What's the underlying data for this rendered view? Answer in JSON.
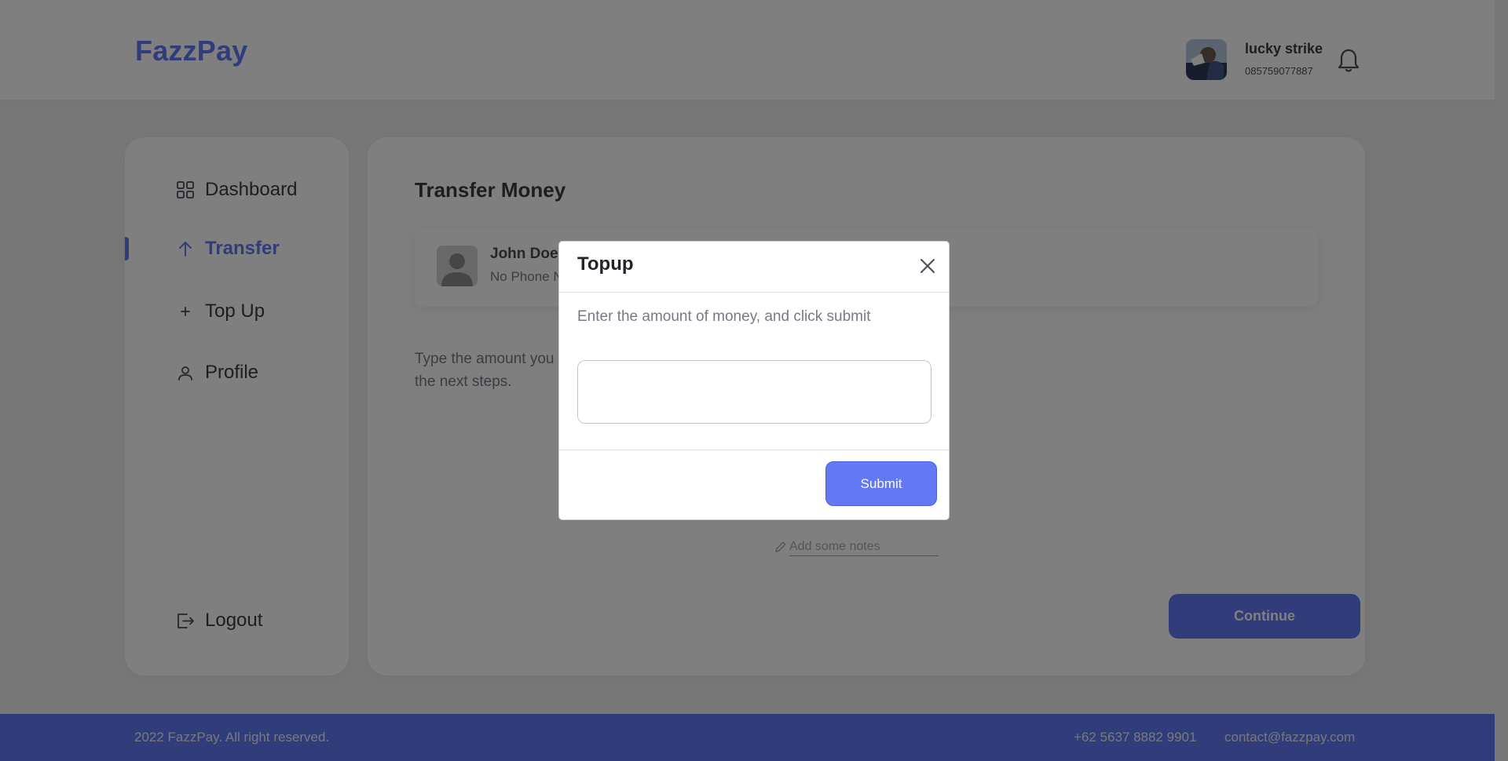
{
  "header": {
    "brand": "FazzPay",
    "user_name": "lucky strike",
    "user_phone": "085759077887"
  },
  "sidebar": {
    "items": [
      {
        "label": "Dashboard",
        "icon": "grid-icon"
      },
      {
        "label": "Transfer",
        "icon": "arrow-up-icon",
        "active": true
      },
      {
        "label": "Top Up",
        "icon": "plus-icon"
      },
      {
        "label": "Profile",
        "icon": "user-icon"
      }
    ],
    "logout_label": "Logout"
  },
  "main": {
    "title": "Transfer Money",
    "recipient_name": "John Doe",
    "recipient_phone": "No Phone Number",
    "instruction": "Type the amount you want to transfer and then press continue to the next steps.",
    "notes_placeholder": "Add some notes",
    "continue_label": "Continue"
  },
  "footer": {
    "copyright": "2022 FazzPay. All right reserved.",
    "phone": "+62 5637 8882 9901",
    "email": "contact@fazzpay.com"
  },
  "modal": {
    "title": "Topup",
    "description": "Enter the amount of money, and click submit",
    "amount_value": "",
    "submit_label": "Submit"
  },
  "colors": {
    "accent": "#6379f4",
    "backdrop": "rgba(0,0,0,0.5)"
  }
}
